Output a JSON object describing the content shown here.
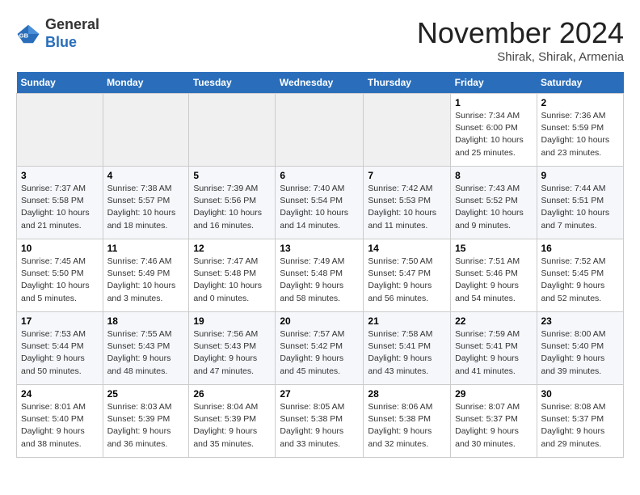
{
  "logo": {
    "general": "General",
    "blue": "Blue"
  },
  "header": {
    "month": "November 2024",
    "location": "Shirak, Shirak, Armenia"
  },
  "weekdays": [
    "Sunday",
    "Monday",
    "Tuesday",
    "Wednesday",
    "Thursday",
    "Friday",
    "Saturday"
  ],
  "weeks": [
    [
      {
        "day": "",
        "info": ""
      },
      {
        "day": "",
        "info": ""
      },
      {
        "day": "",
        "info": ""
      },
      {
        "day": "",
        "info": ""
      },
      {
        "day": "",
        "info": ""
      },
      {
        "day": "1",
        "info": "Sunrise: 7:34 AM\nSunset: 6:00 PM\nDaylight: 10 hours and 25 minutes."
      },
      {
        "day": "2",
        "info": "Sunrise: 7:36 AM\nSunset: 5:59 PM\nDaylight: 10 hours and 23 minutes."
      }
    ],
    [
      {
        "day": "3",
        "info": "Sunrise: 7:37 AM\nSunset: 5:58 PM\nDaylight: 10 hours and 21 minutes."
      },
      {
        "day": "4",
        "info": "Sunrise: 7:38 AM\nSunset: 5:57 PM\nDaylight: 10 hours and 18 minutes."
      },
      {
        "day": "5",
        "info": "Sunrise: 7:39 AM\nSunset: 5:56 PM\nDaylight: 10 hours and 16 minutes."
      },
      {
        "day": "6",
        "info": "Sunrise: 7:40 AM\nSunset: 5:54 PM\nDaylight: 10 hours and 14 minutes."
      },
      {
        "day": "7",
        "info": "Sunrise: 7:42 AM\nSunset: 5:53 PM\nDaylight: 10 hours and 11 minutes."
      },
      {
        "day": "8",
        "info": "Sunrise: 7:43 AM\nSunset: 5:52 PM\nDaylight: 10 hours and 9 minutes."
      },
      {
        "day": "9",
        "info": "Sunrise: 7:44 AM\nSunset: 5:51 PM\nDaylight: 10 hours and 7 minutes."
      }
    ],
    [
      {
        "day": "10",
        "info": "Sunrise: 7:45 AM\nSunset: 5:50 PM\nDaylight: 10 hours and 5 minutes."
      },
      {
        "day": "11",
        "info": "Sunrise: 7:46 AM\nSunset: 5:49 PM\nDaylight: 10 hours and 3 minutes."
      },
      {
        "day": "12",
        "info": "Sunrise: 7:47 AM\nSunset: 5:48 PM\nDaylight: 10 hours and 0 minutes."
      },
      {
        "day": "13",
        "info": "Sunrise: 7:49 AM\nSunset: 5:48 PM\nDaylight: 9 hours and 58 minutes."
      },
      {
        "day": "14",
        "info": "Sunrise: 7:50 AM\nSunset: 5:47 PM\nDaylight: 9 hours and 56 minutes."
      },
      {
        "day": "15",
        "info": "Sunrise: 7:51 AM\nSunset: 5:46 PM\nDaylight: 9 hours and 54 minutes."
      },
      {
        "day": "16",
        "info": "Sunrise: 7:52 AM\nSunset: 5:45 PM\nDaylight: 9 hours and 52 minutes."
      }
    ],
    [
      {
        "day": "17",
        "info": "Sunrise: 7:53 AM\nSunset: 5:44 PM\nDaylight: 9 hours and 50 minutes."
      },
      {
        "day": "18",
        "info": "Sunrise: 7:55 AM\nSunset: 5:43 PM\nDaylight: 9 hours and 48 minutes."
      },
      {
        "day": "19",
        "info": "Sunrise: 7:56 AM\nSunset: 5:43 PM\nDaylight: 9 hours and 47 minutes."
      },
      {
        "day": "20",
        "info": "Sunrise: 7:57 AM\nSunset: 5:42 PM\nDaylight: 9 hours and 45 minutes."
      },
      {
        "day": "21",
        "info": "Sunrise: 7:58 AM\nSunset: 5:41 PM\nDaylight: 9 hours and 43 minutes."
      },
      {
        "day": "22",
        "info": "Sunrise: 7:59 AM\nSunset: 5:41 PM\nDaylight: 9 hours and 41 minutes."
      },
      {
        "day": "23",
        "info": "Sunrise: 8:00 AM\nSunset: 5:40 PM\nDaylight: 9 hours and 39 minutes."
      }
    ],
    [
      {
        "day": "24",
        "info": "Sunrise: 8:01 AM\nSunset: 5:40 PM\nDaylight: 9 hours and 38 minutes."
      },
      {
        "day": "25",
        "info": "Sunrise: 8:03 AM\nSunset: 5:39 PM\nDaylight: 9 hours and 36 minutes."
      },
      {
        "day": "26",
        "info": "Sunrise: 8:04 AM\nSunset: 5:39 PM\nDaylight: 9 hours and 35 minutes."
      },
      {
        "day": "27",
        "info": "Sunrise: 8:05 AM\nSunset: 5:38 PM\nDaylight: 9 hours and 33 minutes."
      },
      {
        "day": "28",
        "info": "Sunrise: 8:06 AM\nSunset: 5:38 PM\nDaylight: 9 hours and 32 minutes."
      },
      {
        "day": "29",
        "info": "Sunrise: 8:07 AM\nSunset: 5:37 PM\nDaylight: 9 hours and 30 minutes."
      },
      {
        "day": "30",
        "info": "Sunrise: 8:08 AM\nSunset: 5:37 PM\nDaylight: 9 hours and 29 minutes."
      }
    ]
  ]
}
